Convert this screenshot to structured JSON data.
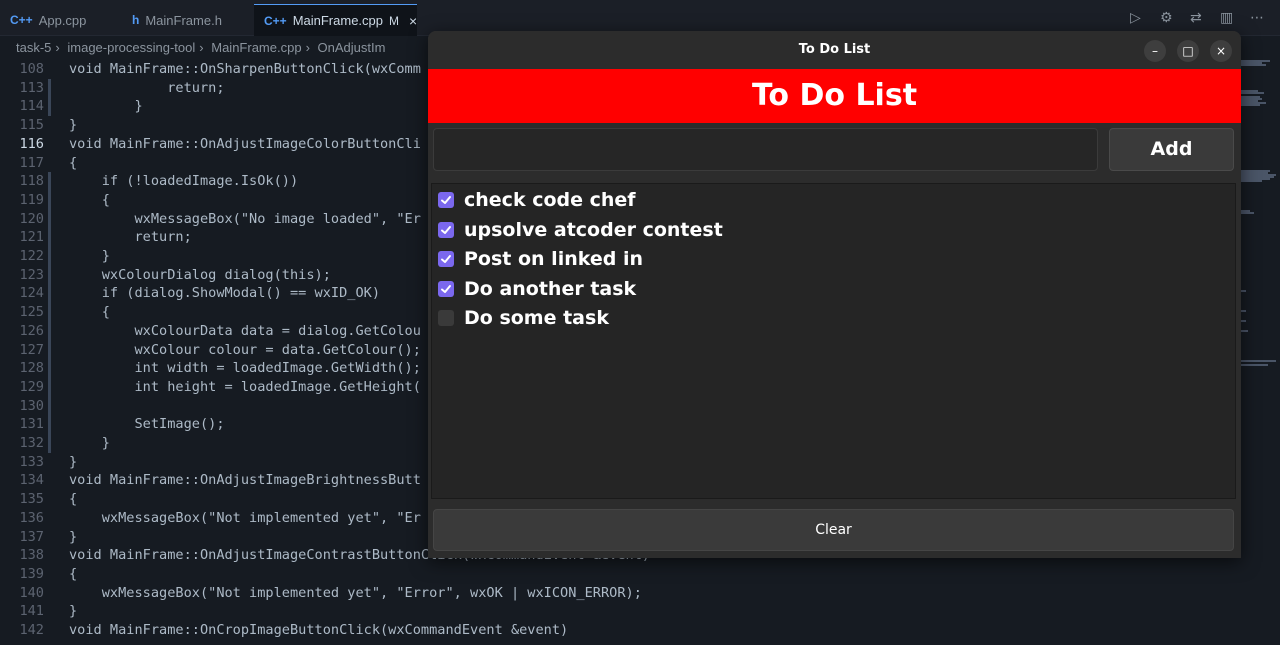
{
  "editor": {
    "tabs": [
      {
        "icon": "C++",
        "label": "App.cpp"
      },
      {
        "icon": "h",
        "label": "MainFrame.h"
      },
      {
        "icon": "C++",
        "label": "MainFrame.cpp",
        "modified": "M",
        "close": "×"
      }
    ],
    "breadcrumb": [
      "task-5",
      "image-processing-tool",
      "MainFrame.cpp",
      "OnAdjustIm"
    ],
    "lines": [
      {
        "n": "108",
        "code": "void MainFrame::OnSharpenButtonClick(wxComm"
      },
      {
        "n": "113",
        "code": "            return;"
      },
      {
        "n": "114",
        "code": "        }"
      },
      {
        "n": "115",
        "code": "}"
      },
      {
        "n": "116",
        "code": "void MainFrame::OnAdjustImageColorButtonCli"
      },
      {
        "n": "117",
        "code": "{"
      },
      {
        "n": "118",
        "code": "    if (!loadedImage.IsOk())"
      },
      {
        "n": "119",
        "code": "    {"
      },
      {
        "n": "120",
        "code": "        wxMessageBox(\"No image loaded\", \"Er"
      },
      {
        "n": "121",
        "code": "        return;"
      },
      {
        "n": "122",
        "code": "    }"
      },
      {
        "n": "123",
        "code": "    wxColourDialog dialog(this);"
      },
      {
        "n": "124",
        "code": "    if (dialog.ShowModal() == wxID_OK)"
      },
      {
        "n": "125",
        "code": "    {"
      },
      {
        "n": "126",
        "code": "        wxColourData data = dialog.GetColou"
      },
      {
        "n": "127",
        "code": "        wxColour colour = data.GetColour();"
      },
      {
        "n": "128",
        "code": "        int width = loadedImage.GetWidth();"
      },
      {
        "n": "129",
        "code": "        int height = loadedImage.GetHeight("
      },
      {
        "n": "130",
        "code": ""
      },
      {
        "n": "131",
        "code": "        SetImage();"
      },
      {
        "n": "132",
        "code": "    }"
      },
      {
        "n": "133",
        "code": "}"
      },
      {
        "n": "134",
        "code": "void MainFrame::OnAdjustImageBrightnessButt"
      },
      {
        "n": "135",
        "code": "{"
      },
      {
        "n": "136",
        "code": "    wxMessageBox(\"Not implemented yet\", \"Er"
      },
      {
        "n": "137",
        "code": "}"
      },
      {
        "n": "138",
        "code": "void MainFrame::OnAdjustImageContrastButtonClick(wxCommandEvent &event)"
      },
      {
        "n": "139",
        "code": "{"
      },
      {
        "n": "140",
        "code": "    wxMessageBox(\"Not implemented yet\", \"Error\", wxOK | wxICON_ERROR);"
      },
      {
        "n": "141",
        "code": "}"
      },
      {
        "n": "142",
        "code": "void MainFrame::OnCropImageButtonClick(wxCommandEvent &event)"
      }
    ]
  },
  "todo": {
    "window_title": "To Do List",
    "header": "To Do List",
    "input_value": "",
    "add_label": "Add",
    "clear_label": "Clear",
    "items": [
      {
        "label": "check code chef",
        "checked": true
      },
      {
        "label": "upsolve atcoder contest",
        "checked": true
      },
      {
        "label": "Post on linked in",
        "checked": true
      },
      {
        "label": "Do another task",
        "checked": true
      },
      {
        "label": "Do some task",
        "checked": false
      }
    ],
    "controls": {
      "minimize": "–",
      "maximize": "□",
      "close": "×"
    },
    "colors": {
      "header": "#ff0000",
      "checkbox": "#7b68ee"
    }
  }
}
